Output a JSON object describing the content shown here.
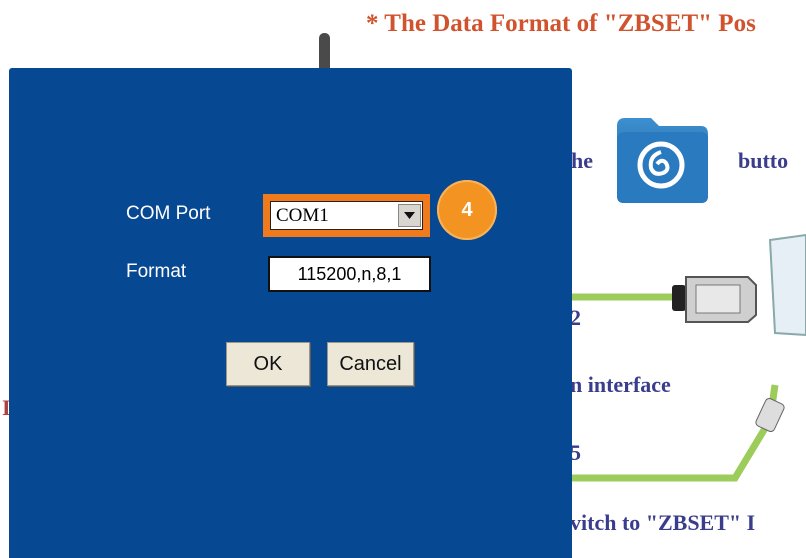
{
  "background": {
    "title": "* The Data Format of \"ZBSET\" Pos",
    "text_he": "he",
    "text_butto": "butto",
    "text_two": "2",
    "text_interface": "n interface",
    "text_five": "5",
    "text_switch": "vitch to \"ZBSET\" I",
    "text_left_mark": "I"
  },
  "dialog": {
    "com_port_label": "COM Port",
    "com_port_value": "COM1",
    "format_label": "Format",
    "format_value": "115200,n,8,1",
    "ok_label": "OK",
    "cancel_label": "Cancel",
    "step_badge": "4"
  },
  "colors": {
    "dialog_bg": "#074892",
    "highlight": "#f07a1c",
    "badge": "#f39422"
  },
  "icons": {
    "folder": "app-folder-icon",
    "combo_arrow": "chevron-down-icon",
    "cable": "serial-cable-icon"
  }
}
